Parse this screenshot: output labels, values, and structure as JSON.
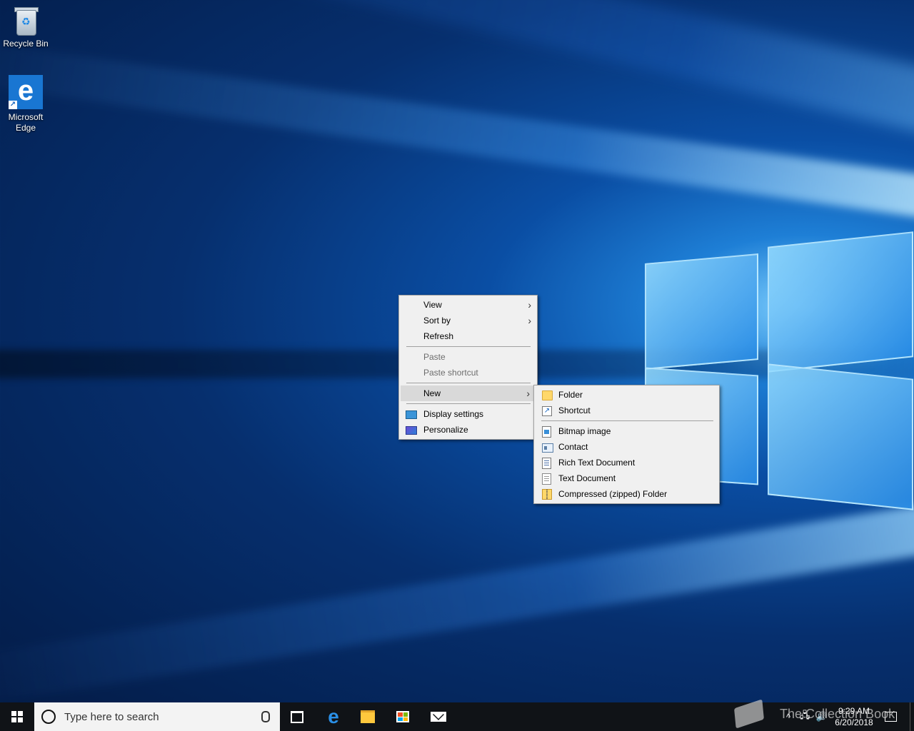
{
  "desktop": {
    "icons": [
      {
        "label": "Recycle Bin",
        "icon": "recycle-bin-icon"
      },
      {
        "label": "Microsoft\nEdge",
        "icon": "edge-icon",
        "glyph": "e"
      }
    ]
  },
  "context_menu": {
    "view": "View",
    "sort_by": "Sort by",
    "refresh": "Refresh",
    "paste": "Paste",
    "paste_shortcut": "Paste shortcut",
    "new": "New",
    "display_settings": "Display settings",
    "personalize": "Personalize",
    "chevron": "›"
  },
  "new_submenu": {
    "folder": "Folder",
    "shortcut": "Shortcut",
    "bitmap_image": "Bitmap image",
    "contact": "Contact",
    "rich_text_document": "Rich Text Document",
    "text_document": "Text Document",
    "compressed_folder": "Compressed (zipped) Folder"
  },
  "taskbar": {
    "search_placeholder": "Type here to search",
    "edge_glyph": "e",
    "clock_time": "9:29 AM",
    "clock_date": "6/20/2018",
    "tray_up": "^"
  },
  "watermark": {
    "text": "The Collection Book"
  },
  "colors": {
    "menu_bg": "#f0f0f0",
    "menu_hover": "#d9d9d9",
    "taskbar_bg": "#101317",
    "edge_blue": "#1976d2"
  }
}
